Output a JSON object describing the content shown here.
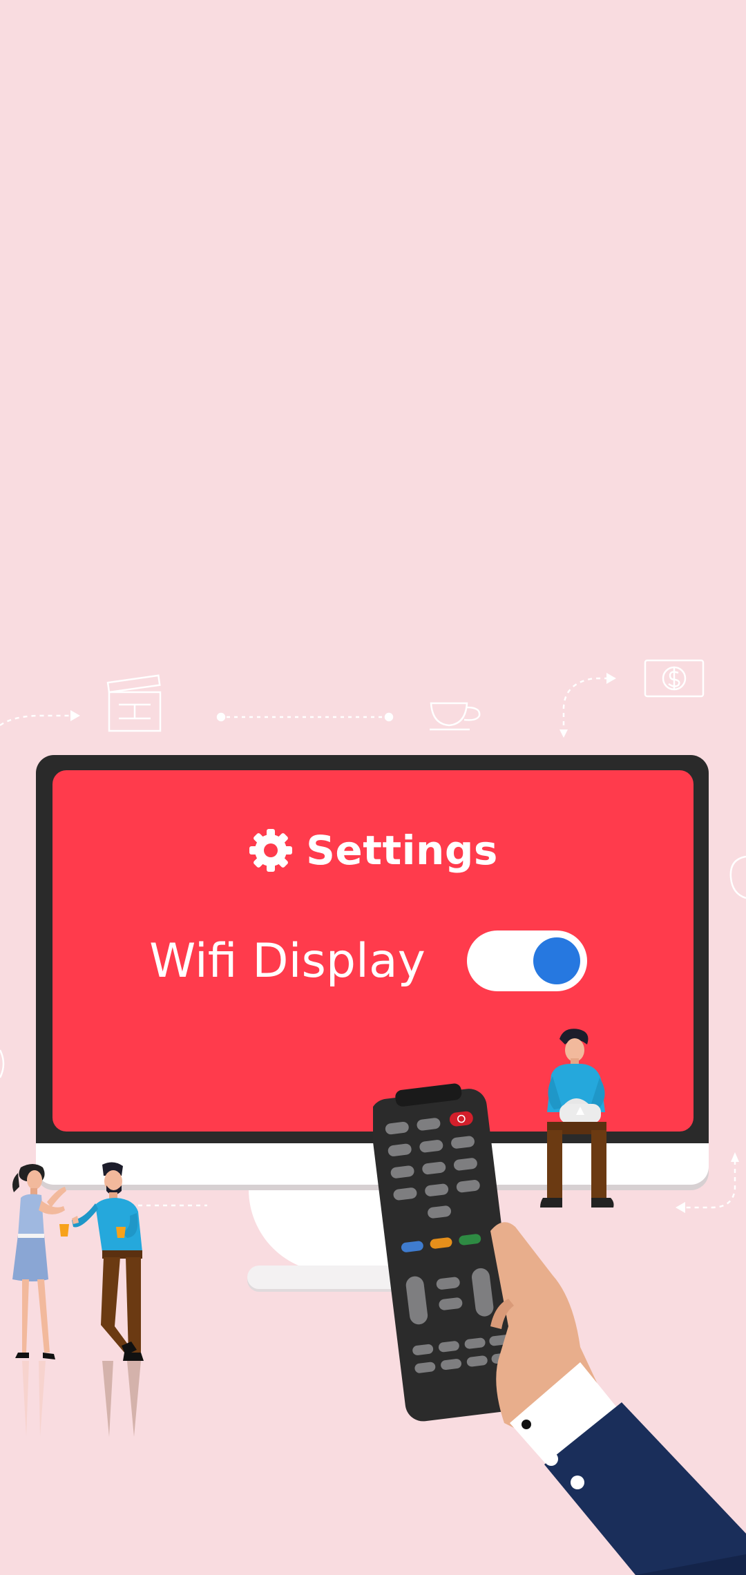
{
  "screen": {
    "settings_label": "Settings",
    "settings_icon": "gear-icon",
    "wifi_display_label": "Wifi Display",
    "wifi_display_enabled": true
  },
  "colors": {
    "background": "#f9dce0",
    "screen": "#ff3b4c",
    "bezel": "#2a2a2a",
    "toggle_knob": "#2678e0",
    "remote": "#2b2b2b",
    "sleeve": "#1a2e5a"
  },
  "decor_icons": [
    "clapperboard-icon",
    "coffee-cup-icon",
    "dollar-bill-icon",
    "remote-control",
    "hand"
  ]
}
